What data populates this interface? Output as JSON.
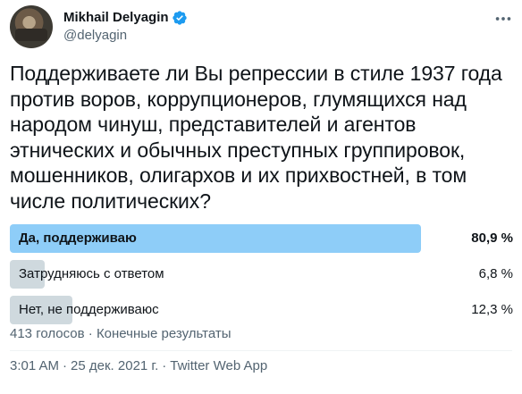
{
  "author": {
    "name": "Mikhail Delyagin",
    "handle": "@delyagin",
    "verified": true,
    "icons": [
      "verified-badge-icon",
      "more-icon"
    ]
  },
  "tweet": {
    "text": "Поддерживаете ли Вы репрессии в стиле 1937 года против воров, коррупционеров, глумящихся над народом чинуш, представителей и агентов этнических и обычных преступных группировок, мошенников, олигархов и их прихвостней, в том числе политических?"
  },
  "poll": {
    "options": [
      {
        "label": "Да, поддерживаю",
        "percent": "80,9 %",
        "fraction": 0.809,
        "winner": true
      },
      {
        "label": "Затрудняюсь с ответом",
        "percent": "6,8 %",
        "fraction": 0.068,
        "winner": false
      },
      {
        "label": "Нет, не поддерживаюс",
        "percent": "12,3 %",
        "fraction": 0.123,
        "winner": false
      }
    ],
    "votes": "413 голосов",
    "separator": "·",
    "status": "Конечные результаты"
  },
  "meta": {
    "time": "3:01 AM",
    "separator": "·",
    "date": "25 дек. 2021 г.",
    "source": "Twitter Web App"
  },
  "colors": {
    "winner_bar": "#8ecdf8",
    "bar": "#cfd9de",
    "verified": "#1d9bf0",
    "secondary_text": "#536471"
  }
}
